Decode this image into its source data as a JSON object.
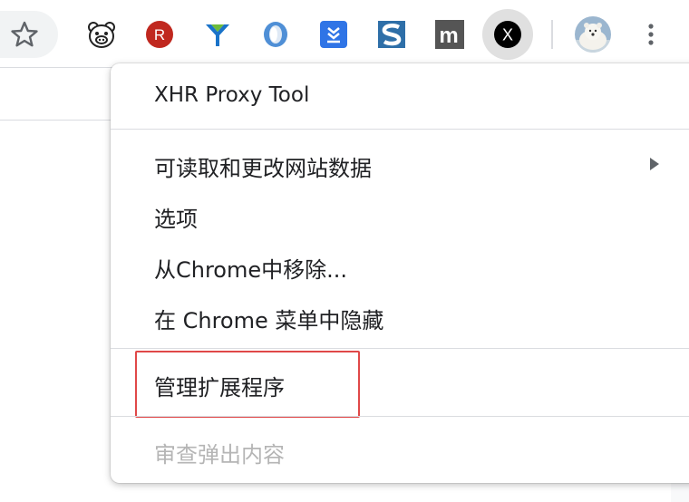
{
  "toolbar": {
    "extensions": [
      {
        "icon": "pig-face-icon"
      },
      {
        "icon": "letter-r-icon",
        "letter": "R",
        "color": "#c0281f"
      },
      {
        "icon": "y-funnel-icon"
      },
      {
        "icon": "ring-icon"
      },
      {
        "icon": "download-tray-icon",
        "color": "#2f74e6"
      },
      {
        "icon": "letter-s-icon",
        "color": "#2e6fa8"
      },
      {
        "icon": "letter-m-icon",
        "letter": "m",
        "color": "#555555"
      },
      {
        "icon": "letter-x-icon",
        "letter": "X",
        "color": "#000000",
        "active": true
      }
    ],
    "profile": {
      "icon": "polar-bear-avatar"
    },
    "menu_icon": "more-vert-icon"
  },
  "menu": {
    "title": "XHR Proxy Tool",
    "items": [
      {
        "label": "可读取和更改网站数据",
        "has_submenu": true
      },
      {
        "label": "选项"
      },
      {
        "label": "从Chrome中移除..."
      },
      {
        "label": "在 Chrome 菜单中隐藏"
      },
      {
        "label": "管理扩展程序",
        "highlighted": true
      },
      {
        "label": "审查弹出内容",
        "disabled": true
      }
    ]
  },
  "colors": {
    "highlight_box": "#e04848",
    "disabled_text": "#b5b5b5",
    "active_bg": "#e0e0e0"
  }
}
